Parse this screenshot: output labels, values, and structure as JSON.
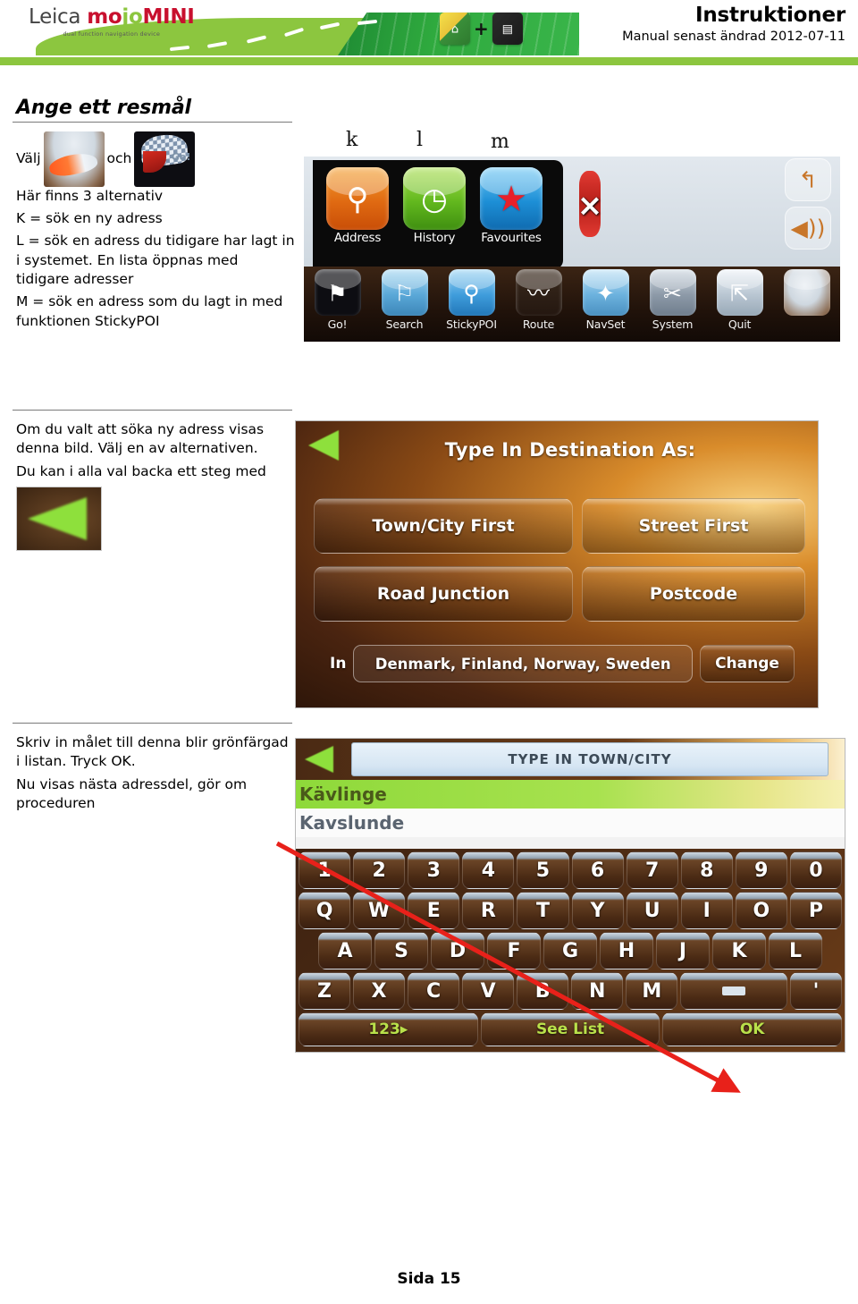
{
  "header": {
    "logo_leica": "Leica ",
    "logo_mo": "mo",
    "logo_jo": "jo",
    "logo_mini": "MINI",
    "logo_subtitle": "dual function navigation device",
    "title": "Instruktioner",
    "subtitle": "Manual senast ändrad 2012-07-11",
    "brand_green": "#8CC63F",
    "brand_red": "#C8102E"
  },
  "section": {
    "title": "Ange ett resmål"
  },
  "block1": {
    "line_valj": "Välj",
    "line_och": "och",
    "p1": "Här finns 3 alternativ",
    "p2": "K = sök en ny adress",
    "p3": "L = sök en adress du tidigare har lagt in i systemet. En lista öppnas med tidigare adresser",
    "p4": "M = sök en adress som du lagt in med funktionen StickyPOI"
  },
  "block2": {
    "p1": "Om du valt att söka ny adress visas denna bild. Välj en av alternativen.",
    "p2": "Du kan i alla val backa ett steg med"
  },
  "block3": {
    "p1": "Skriv in målet till denna blir grönfärgad i listan. Tryck OK.",
    "p2": "Nu visas nästa adressdel, gör om proceduren"
  },
  "annotations": {
    "k": "k",
    "l": "l",
    "m": "m",
    "arrow_color": "#E8211A"
  },
  "shot1": {
    "popup_tiles": [
      {
        "label": "Address",
        "glyph": "⚲",
        "icon": "signpost-icon"
      },
      {
        "label": "History",
        "glyph": "◷",
        "icon": "clock-icon"
      },
      {
        "label": "Favourites",
        "glyph": "★",
        "icon": "star-icon"
      }
    ],
    "toolbar": [
      {
        "label": "Go!",
        "glyph": "⚑",
        "icon": "checkered-flag-icon"
      },
      {
        "label": "Search",
        "glyph": "⚐",
        "icon": "map-pins-icon"
      },
      {
        "label": "StickyPOI",
        "glyph": "⚲",
        "icon": "pushpin-icon"
      },
      {
        "label": "Route",
        "glyph": "〰",
        "icon": "road-icon"
      },
      {
        "label": "NavSet",
        "glyph": "✦",
        "icon": "compass-icon"
      },
      {
        "label": "System",
        "glyph": "✂",
        "icon": "tools-icon"
      },
      {
        "label": "Quit",
        "glyph": "⇱",
        "icon": "exit-person-icon"
      },
      {
        "label": "",
        "glyph": "",
        "icon": "swoosh-icon"
      }
    ],
    "right_controls": [
      {
        "icon": "back-arrow-icon",
        "glyph": "↰"
      },
      {
        "icon": "volume-icon",
        "glyph": "🔊"
      }
    ],
    "car_marker": "×"
  },
  "shot2": {
    "title": "Type In Destination As:",
    "buttons": [
      "Town/City First",
      "Street First",
      "Road Junction",
      "Postcode"
    ],
    "in_label": "In",
    "country": "Denmark, Finland, Norway, Sweden",
    "change_label": "Change"
  },
  "shot3": {
    "field_label": "TYPE IN TOWN/CITY",
    "list": [
      {
        "text": "Kävlinge",
        "highlighted": true
      },
      {
        "text": "Kavslunde",
        "highlighted": false
      }
    ],
    "keyboard": {
      "row1": [
        "1",
        "2",
        "3",
        "4",
        "5",
        "6",
        "7",
        "8",
        "9",
        "0"
      ],
      "row2": [
        "Q",
        "W",
        "E",
        "R",
        "T",
        "Y",
        "U",
        "I",
        "O",
        "P"
      ],
      "row3": [
        "A",
        "S",
        "D",
        "F",
        "G",
        "H",
        "J",
        "K",
        "L"
      ],
      "row4": [
        "Z",
        "X",
        "C",
        "V",
        "B",
        "N",
        "M"
      ],
      "space_key": "space-key",
      "apostrophe_key": "'",
      "bottom": [
        "123▸",
        "See List",
        "OK"
      ]
    }
  },
  "footer": {
    "page": "Sida 15"
  }
}
